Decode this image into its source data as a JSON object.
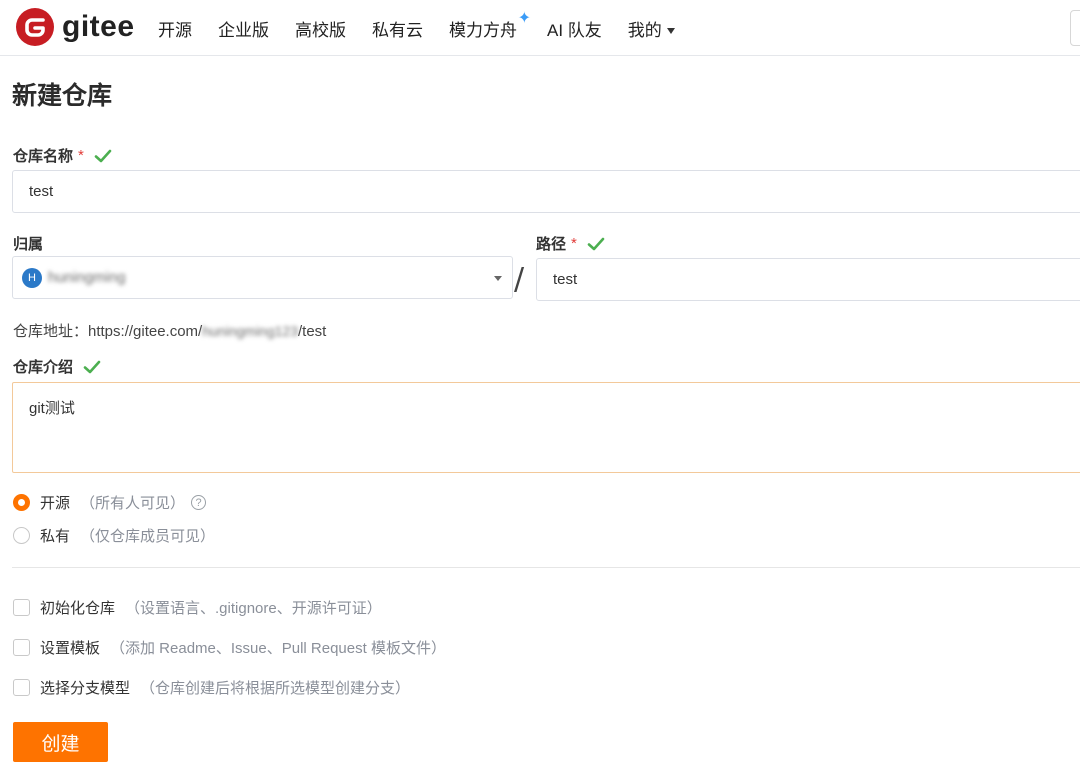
{
  "brand": {
    "name": "gitee"
  },
  "nav": {
    "items": [
      "开源",
      "企业版",
      "高校版",
      "私有云",
      "模力方舟",
      "AI 队友"
    ],
    "me": "我的"
  },
  "page": {
    "title": "新建仓库"
  },
  "form": {
    "name": {
      "label": "仓库名称",
      "required": "*",
      "value": "test"
    },
    "owner": {
      "label": "归属",
      "avatar_letter": "H",
      "value": "huningming"
    },
    "separator": "/",
    "path": {
      "label": "路径",
      "required": "*",
      "value": "test"
    },
    "repo_url": {
      "prefix": "仓库地址：https://gitee.com/",
      "user": "huningming123",
      "suffix": "/test"
    },
    "desc": {
      "label": "仓库介绍",
      "value": "git测试"
    },
    "visibility": {
      "public": {
        "label": "开源",
        "hint": "（所有人可见）",
        "help": "?"
      },
      "private": {
        "label": "私有",
        "hint": "（仅仓库成员可见）"
      },
      "selected": "public"
    },
    "options": [
      {
        "label": "初始化仓库",
        "hint": "（设置语言、.gitignore、开源许可证）"
      },
      {
        "label": "设置模板",
        "hint": "（添加 Readme、Issue、Pull Request 模板文件）"
      },
      {
        "label": "选择分支模型",
        "hint": "（仓库创建后将根据所选模型创建分支）"
      }
    ],
    "submit": "创建"
  },
  "colors": {
    "accent": "#fe7300",
    "brand_red": "#c71d23",
    "valid_green": "#4caf50",
    "required_red": "#e23c39"
  }
}
